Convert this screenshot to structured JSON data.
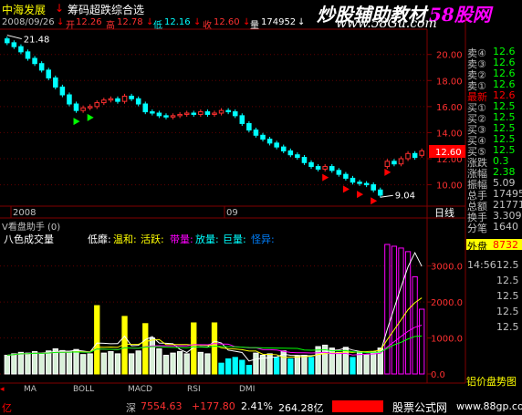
{
  "header": {
    "stock_name": "中海发展",
    "indicator_name": "筹码超跌综合选",
    "watermark_title": "炒股辅助教材",
    "watermark_site_cn": "58股网",
    "watermark_url": "www.58Gu.com"
  },
  "info": {
    "date": "2008/09/26",
    "open_label": "开",
    "open": "12.26",
    "high_label": "高",
    "high": "12.78",
    "low_label": "低",
    "low": "12.16",
    "close_label": "收",
    "close": "12.60",
    "vol_label": "量",
    "volume": "174952",
    "high_mark": "21.48",
    "low_mark": "9.04",
    "cur_price_tag": "12.60"
  },
  "price_axis": [
    "20.00",
    "18.00",
    "16.00",
    "14.00",
    "12.00",
    "10.00"
  ],
  "time_axis": {
    "left": "2008",
    "mid": "09",
    "period": "日线"
  },
  "sub_panel": {
    "selector": "V看盘助手 (0)",
    "name": "八色成交量",
    "legend": [
      {
        "label": "低靡:",
        "color": "#ffffff"
      },
      {
        "label": "温和:",
        "color": "#ffff00"
      },
      {
        "label": "活跃:",
        "color": "#ffff00"
      },
      {
        "label": "带量:",
        "color": "#ff00ff"
      },
      {
        "label": "放量:",
        "color": "#00ffff"
      },
      {
        "label": "巨量:",
        "color": "#00ffff"
      },
      {
        "label": "怪异:",
        "color": "#0080ff"
      }
    ],
    "axis": [
      "3000.0",
      "2000.0",
      "1000.0",
      "0.0"
    ]
  },
  "tabs": [
    "MA",
    "BOLL",
    "MACD",
    "RSI",
    "DMI"
  ],
  "right_panel": {
    "rows": [
      {
        "label": "卖④",
        "value": "12.6",
        "color": "#00ff00"
      },
      {
        "label": "卖③",
        "value": "12.6",
        "color": "#00ff00"
      },
      {
        "label": "卖②",
        "value": "12.6",
        "color": "#00ff00"
      },
      {
        "label": "卖①",
        "value": "12.6",
        "color": "#00ff00"
      },
      {
        "label": "最新",
        "value": "12.6",
        "color": "#ff0000"
      },
      {
        "label": "买①",
        "value": "12.5",
        "color": "#00ff00"
      },
      {
        "label": "买②",
        "value": "12.5",
        "color": "#00ff00"
      },
      {
        "label": "买③",
        "value": "12.5",
        "color": "#00ff00"
      },
      {
        "label": "买④",
        "value": "12.5",
        "color": "#00ff00"
      },
      {
        "label": "买⑤",
        "value": "12.5",
        "color": "#00ff00"
      },
      {
        "label": "涨跌",
        "value": "0.3",
        "color": "#00ff00"
      },
      {
        "label": "涨幅",
        "value": "2.38",
        "color": "#00ff00"
      },
      {
        "label": "振幅",
        "value": "5.09",
        "color": "#c0c0c0"
      },
      {
        "label": "总手",
        "value": "17495",
        "color": "#c0c0c0"
      },
      {
        "label": "总额",
        "value": "21771",
        "color": "#c0c0c0"
      },
      {
        "label": "换手",
        "value": "3.309",
        "color": "#c0c0c0"
      },
      {
        "label": "分笔",
        "value": "1640",
        "color": "#c0c0c0"
      }
    ],
    "outer_label": "外盘",
    "outer_value": "8732",
    "ticks": [
      {
        "time": "14:56",
        "value": "12.5"
      },
      {
        "time": "",
        "value": "12.5"
      },
      {
        "time": "",
        "value": "12.5"
      },
      {
        "time": "",
        "value": "12.5"
      },
      {
        "time": "",
        "value": "12.5"
      }
    ],
    "bottom_label": "铝价盘势图"
  },
  "status": {
    "left_char": "亿",
    "index_name": "深",
    "index_value": "7554.63",
    "index_change": "+177.80",
    "index_pct": "2.41%",
    "index_amount": "264.28亿",
    "site_name": "股票公式网",
    "site_url": "www.88gp.com"
  },
  "chart_data": [
    {
      "type": "candlestick",
      "title": "中海发展 日线",
      "ylabel": "",
      "xlabel": "",
      "ylim": [
        8.5,
        21.8
      ],
      "x": [
        1,
        2,
        3,
        4,
        5,
        6,
        7,
        8,
        9,
        10,
        11,
        12,
        13,
        14,
        15,
        16,
        17,
        18,
        19,
        20,
        21,
        22,
        23,
        24,
        25,
        26,
        27,
        28,
        29,
        30,
        31,
        32,
        33,
        34,
        35,
        36,
        37,
        38,
        39,
        40,
        41,
        42,
        43,
        44,
        45,
        46,
        47,
        48,
        49,
        50,
        51,
        52,
        53,
        54,
        55,
        56,
        57,
        58,
        59,
        60,
        61
      ],
      "open": [
        21.2,
        20.9,
        20.6,
        20.2,
        19.7,
        19.3,
        18.8,
        18.2,
        17.5,
        16.9,
        16.2,
        15.7,
        15.9,
        16.0,
        16.3,
        16.5,
        16.6,
        16.4,
        16.8,
        16.6,
        16.2,
        15.6,
        15.5,
        15.3,
        15.2,
        15.3,
        15.4,
        15.5,
        15.4,
        15.6,
        15.4,
        15.5,
        15.7,
        15.6,
        15.3,
        14.7,
        14.2,
        13.8,
        13.5,
        13.2,
        12.9,
        12.6,
        12.3,
        12.1,
        11.7,
        11.4,
        11.2,
        11.4,
        11.1,
        10.8,
        10.5,
        10.2,
        10.1,
        10.0,
        9.6,
        11.4,
        11.8,
        11.6,
        12.0,
        12.4,
        12.26
      ],
      "close": [
        20.9,
        20.6,
        20.2,
        19.7,
        19.3,
        18.8,
        18.2,
        17.5,
        16.9,
        16.2,
        15.7,
        15.9,
        16.0,
        16.3,
        16.5,
        16.6,
        16.4,
        16.8,
        16.6,
        16.2,
        15.6,
        15.5,
        15.3,
        15.2,
        15.3,
        15.4,
        15.5,
        15.4,
        15.6,
        15.4,
        15.5,
        15.7,
        15.6,
        15.3,
        14.7,
        14.2,
        13.8,
        13.5,
        13.2,
        12.9,
        12.6,
        12.3,
        12.1,
        11.7,
        11.4,
        11.2,
        11.4,
        11.1,
        10.8,
        10.5,
        10.2,
        10.1,
        10.0,
        9.6,
        9.2,
        11.8,
        11.6,
        12.0,
        12.4,
        12.1,
        12.6
      ],
      "high_mark": 21.48,
      "low_mark": 9.04
    },
    {
      "type": "bar",
      "title": "八色成交量",
      "ylabel": "",
      "xlabel": "",
      "ylim": [
        0,
        3600
      ],
      "x": [
        1,
        2,
        3,
        4,
        5,
        6,
        7,
        8,
        9,
        10,
        11,
        12,
        13,
        14,
        15,
        16,
        17,
        18,
        19,
        20,
        21,
        22,
        23,
        24,
        25,
        26,
        27,
        28,
        29,
        30,
        31,
        32,
        33,
        34,
        35,
        36,
        37,
        38,
        39,
        40,
        41,
        42,
        43,
        44,
        45,
        46,
        47,
        48,
        49,
        50,
        51,
        52,
        53,
        54,
        55,
        56,
        57,
        58,
        59,
        60,
        61
      ],
      "values": [
        520,
        560,
        600,
        580,
        620,
        560,
        640,
        700,
        650,
        620,
        680,
        540,
        560,
        1900,
        580,
        620,
        560,
        1600,
        560,
        640,
        1400,
        1000,
        700,
        520,
        580,
        620,
        560,
        1420,
        600,
        560,
        1420,
        300,
        420,
        460,
        380,
        240,
        580,
        520,
        560,
        460,
        640,
        420,
        500,
        520,
        460,
        760,
        800,
        720,
        600,
        740,
        460,
        620,
        540,
        620,
        720,
        3700,
        3550,
        3500,
        3400,
        2700,
        1800
      ]
    }
  ]
}
